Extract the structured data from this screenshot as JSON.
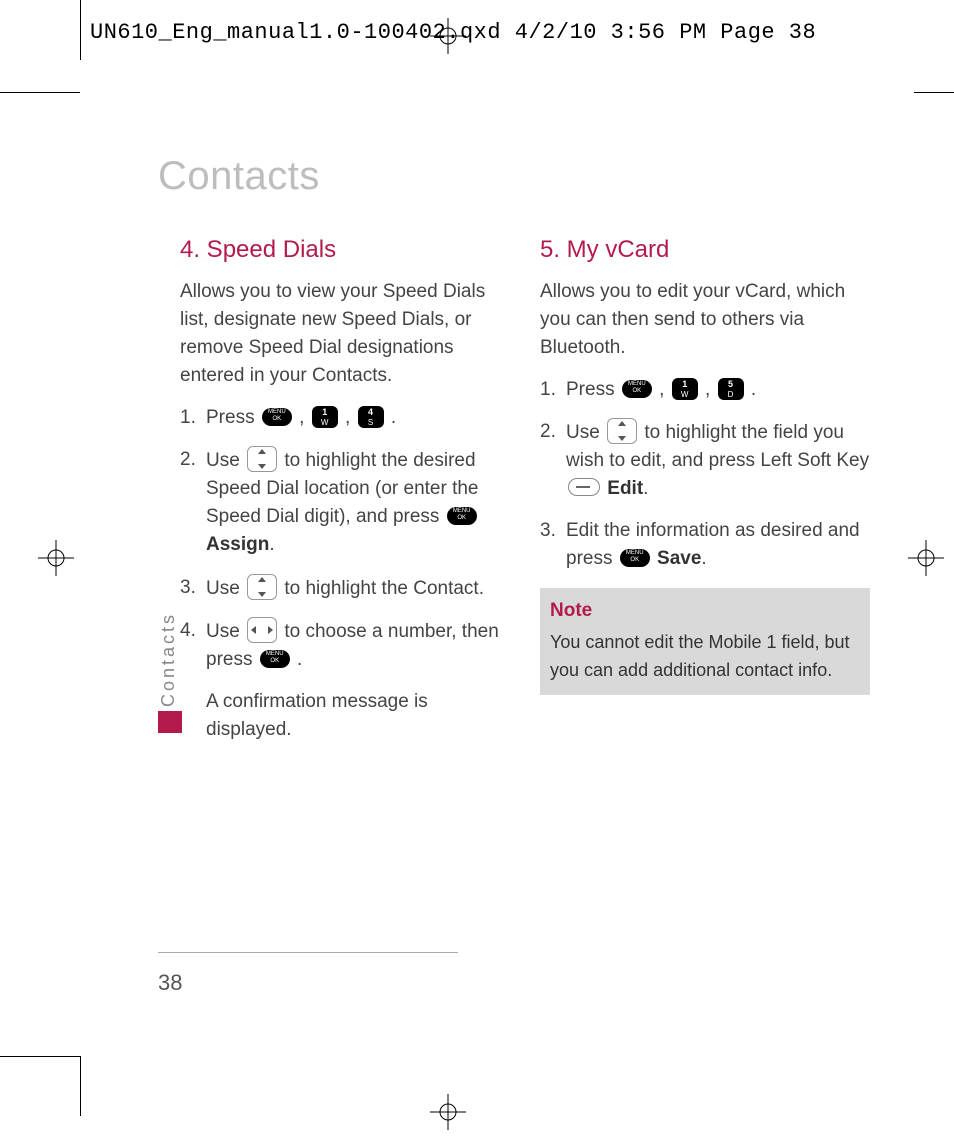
{
  "slug": "UN610_Eng_manual1.0-100402.qxd  4/2/10  3:56 PM  Page 38",
  "chapter": "Contacts",
  "side_tab": "Contacts",
  "page_number": "38",
  "left": {
    "heading": "4. Speed Dials",
    "intro": "Allows you to view your Speed Dials list, designate new Speed Dials, or remove Speed Dial designations entered in your Contacts.",
    "steps": {
      "s1": {
        "num": "1.",
        "a": "Press ",
        "b": " , ",
        "c": " , ",
        "d": " ."
      },
      "s2": {
        "num": "2.",
        "a": "Use ",
        "b": " to highlight the desired Speed Dial location (or enter the Speed Dial digit), and press ",
        "assign": "Assign",
        "c": "."
      },
      "s3": {
        "num": "3.",
        "a": "Use ",
        "b": " to highlight the Contact."
      },
      "s4": {
        "num": "4.",
        "a": "Use ",
        "b": " to choose a number, then press ",
        "c": " ."
      },
      "s4_cont": "A confirmation message is displayed."
    },
    "key4": {
      "big": "4",
      "small": "S"
    },
    "key1": {
      "big": "1",
      "small": "W"
    }
  },
  "right": {
    "heading": "5. My vCard",
    "intro": "Allows you to edit your vCard, which you can then send to others via Bluetooth.",
    "steps": {
      "s1": {
        "num": "1.",
        "a": "Press ",
        "b": " , ",
        "c": " , ",
        "d": " ."
      },
      "s2": {
        "num": "2.",
        "a": "Use ",
        "b": " to highlight the field you wish to edit, and press Left Soft Key ",
        "edit": "Edit",
        "c": "."
      },
      "s3": {
        "num": "3.",
        "a": "Edit the information as desired and press ",
        "save": "Save",
        "b": "."
      }
    },
    "key5": {
      "big": "5",
      "small": "D"
    },
    "key1": {
      "big": "1",
      "small": "W"
    },
    "note": {
      "title": "Note",
      "body": "You cannot edit the Mobile 1 field, but you can add additional contact info."
    }
  }
}
